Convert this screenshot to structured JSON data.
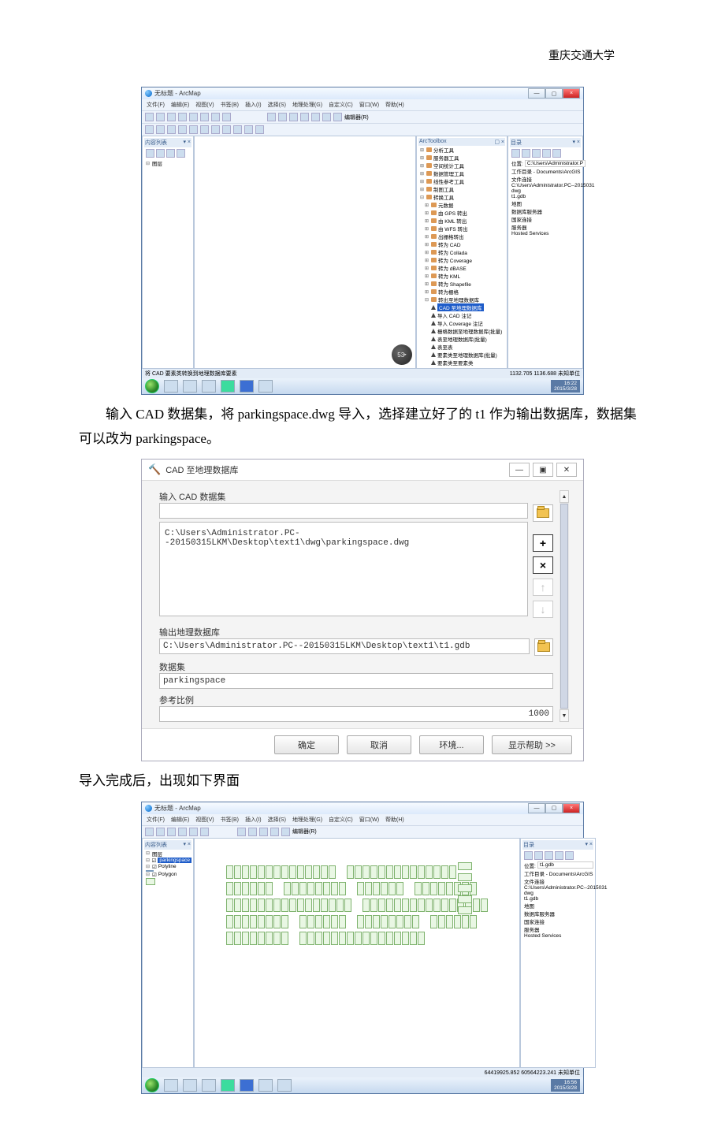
{
  "header": {
    "university": "重庆交通大学"
  },
  "para1": "输入 CAD 数据集，将 parkingspace.dwg 导入，选择建立好了的 t1 作为输出数据库，数据集可以改为 parkingspace。",
  "para2": "导入完成后，出现如下界面",
  "arcmap": {
    "title": "无标题 - ArcMap",
    "menu": [
      "文件(F)",
      "编辑(E)",
      "视图(V)",
      "书签(B)",
      "插入(I)",
      "选择(S)",
      "地理处理(G)",
      "自定义(C)",
      "窗口(W)",
      "帮助(H)"
    ],
    "editor_label": "编辑器(R)",
    "toc_title": "内容列表",
    "toc_root": "图层",
    "toc_layer1": "parkingspace",
    "toc_sub1": "Polyline",
    "toc_sub2": "Polygon",
    "status_hint": "将 CAD 要素类转换到地理数据库要素",
    "coords1": "1132.705  1136.688 未知单位",
    "coords2": "64419925.852  60564223.241 未知单位",
    "nav_value": "53",
    "taskbar": {
      "time": "16:22",
      "date": "2015/3/28",
      "time2": "16:56"
    }
  },
  "arctoolbox": {
    "title": "ArcToolbox",
    "items": [
      "分析工具",
      "服务器工具",
      "空间统计工具",
      "数据管理工具",
      "线性参考工具",
      "制图工具",
      "转换工具"
    ],
    "conv_children": [
      "元数据",
      "由 GPS 转出",
      "由 KML 转出",
      "由 WFS 转出",
      "出栅格转出",
      "转为 CAD",
      "转为 Collada",
      "转为 Coverage",
      "转为 dBASE",
      "转为 KML",
      "转为 Shapefile",
      "转为栅格",
      "转出至地理数据库"
    ],
    "gdb_children": [
      "CAD 至地理数据库",
      "导入 CAD 注记",
      "导入 Coverage 注记",
      "栅格数据至地理数据库(批量)",
      "表至地理数据库(批量)",
      "表至表",
      "要素类至地理数据库(批量)",
      "要素类至要素类"
    ]
  },
  "catalog": {
    "title": "目录",
    "loc_label": "位置:",
    "loc_value": "C:\\Users\\Administrator.P",
    "loc_value2": "t1.gdb",
    "items": [
      "工作目录 - Documents\\ArcGIS",
      "文件连接",
      "C:\\Users\\Administrator.PC--2015031",
      "dwg",
      "t1.gdb",
      "地图",
      "数据库服务器",
      "国家连接",
      "服务器",
      "Hosted Services"
    ]
  },
  "dialog": {
    "title": "CAD 至地理数据库",
    "label_input": "输入 CAD 数据集",
    "input_path": "C:\\Users\\Administrator.PC--20150315LKM\\Desktop\\text1\\dwg\\parkingspace.dwg",
    "label_outgdb": "输出地理数据库",
    "output_gdb": "C:\\Users\\Administrator.PC--20150315LKM\\Desktop\\text1\\t1.gdb",
    "label_dataset": "数据集",
    "dataset": "parkingspace",
    "label_refscale": "参考比例",
    "refscale": "1000",
    "btn_ok": "确定",
    "btn_cancel": "取消",
    "btn_env": "环境...",
    "btn_help": "显示帮助 >>"
  }
}
